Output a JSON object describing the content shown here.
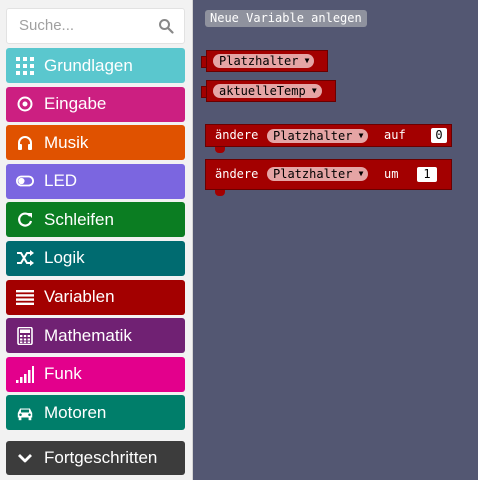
{
  "search": {
    "placeholder": "Suche..."
  },
  "categories": [
    {
      "label": "Grundlagen",
      "icon": "grid-icon",
      "color": "#5ac7ce"
    },
    {
      "label": "Eingabe",
      "icon": "target-icon",
      "color": "#cc1f81"
    },
    {
      "label": "Musik",
      "icon": "headphones-icon",
      "color": "#e05200"
    },
    {
      "label": "LED",
      "icon": "toggle-icon",
      "color": "#7b66e0"
    },
    {
      "label": "Schleifen",
      "icon": "refresh-icon",
      "color": "#0b7d22"
    },
    {
      "label": "Logik",
      "icon": "shuffle-icon",
      "color": "#006b70"
    },
    {
      "label": "Variablen",
      "icon": "list-icon",
      "color": "#a30000"
    },
    {
      "label": "Mathematik",
      "icon": "calculator-icon",
      "color": "#702173"
    },
    {
      "label": "Funk",
      "icon": "signal-icon",
      "color": "#e3008c"
    },
    {
      "label": "Motoren",
      "icon": "car-icon",
      "color": "#007e6a"
    }
  ],
  "advanced": {
    "label": "Fortgeschritten",
    "icon": "chevron-down-icon",
    "color": "#3c3c3c"
  },
  "flyout": {
    "new_variable_button": "Neue Variable anlegen",
    "variables": [
      "Platzhalter",
      "aktuelleTemp"
    ],
    "set_block": {
      "prefix": "ändere",
      "variable": "Platzhalter",
      "word": "auf",
      "value": "0"
    },
    "change_block": {
      "prefix": "ändere",
      "variable": "Platzhalter",
      "word": "um",
      "value": "1"
    }
  }
}
